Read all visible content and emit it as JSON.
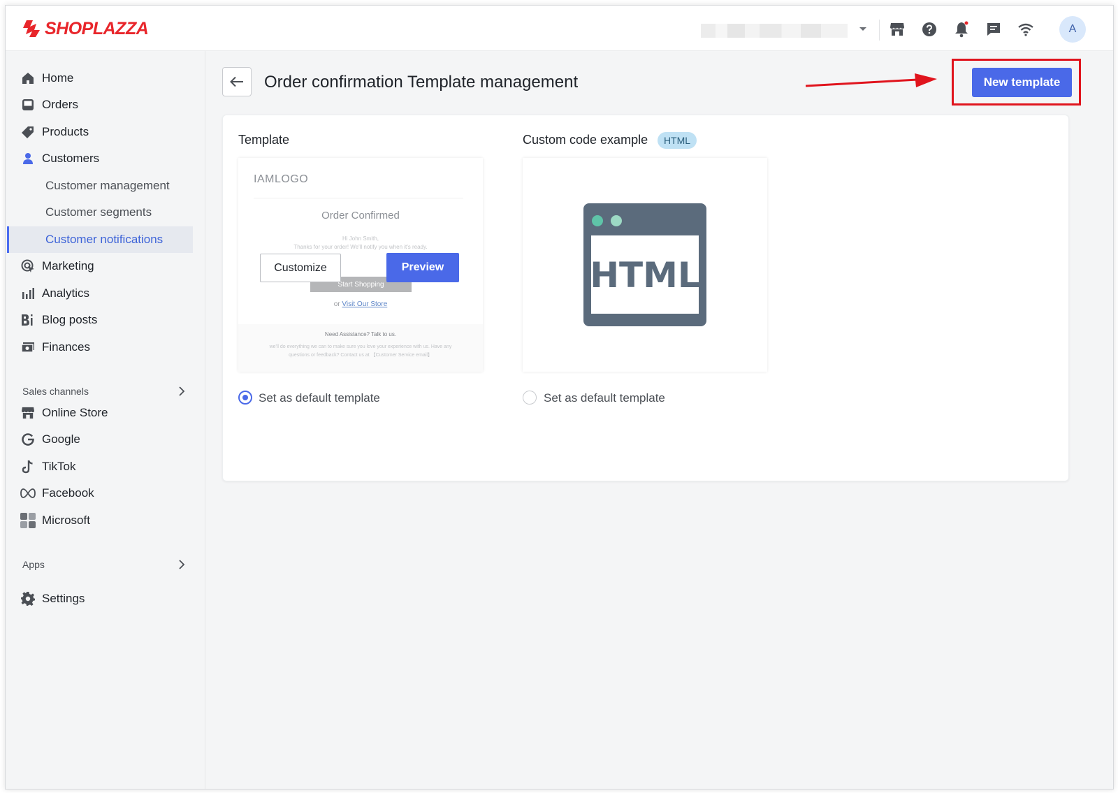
{
  "brand": {
    "name": "SHOPLAZZA",
    "color": "#e8262b"
  },
  "topbar": {
    "icons": [
      "store-icon",
      "help-icon",
      "bell-icon",
      "chat-icon",
      "wifi-icon"
    ],
    "avatar_initial": "A"
  },
  "sidebar": {
    "items": [
      {
        "label": "Home",
        "icon": "home-icon"
      },
      {
        "label": "Orders",
        "icon": "inbox-icon"
      },
      {
        "label": "Products",
        "icon": "tag-icon"
      },
      {
        "label": "Customers",
        "icon": "person-icon"
      },
      {
        "label": "Marketing",
        "icon": "target-icon"
      },
      {
        "label": "Analytics",
        "icon": "bar-chart-icon"
      },
      {
        "label": "Blog posts",
        "icon": "blog-icon"
      },
      {
        "label": "Finances",
        "icon": "finance-icon"
      }
    ],
    "sub_items": [
      {
        "label": "Customer management"
      },
      {
        "label": "Customer segments"
      },
      {
        "label": "Customer notifications",
        "active": true
      }
    ],
    "sales_channels_label": "Sales channels",
    "channels": [
      {
        "label": "Online Store",
        "icon": "store-icon"
      },
      {
        "label": "Google",
        "icon": "google-icon"
      },
      {
        "label": "TikTok",
        "icon": "tiktok-icon"
      },
      {
        "label": "Facebook",
        "icon": "meta-icon"
      },
      {
        "label": "Microsoft",
        "icon": "microsoft-icon"
      }
    ],
    "apps_label": "Apps",
    "settings_label": "Settings"
  },
  "page": {
    "title": "Order confirmation Template management",
    "new_template_label": "New template"
  },
  "templates": {
    "col1_title": "Template",
    "col2_title": "Custom code example",
    "html_badge": "HTML",
    "preview": {
      "logo": "IAMLOGO",
      "title": "Order Confirmed",
      "greeting": "Hi John Smith,",
      "message": "Thanks for your order! We'll notify you when it's ready.",
      "shop_button": "Start Shopping",
      "or_text": "or",
      "visit_link": "Visit Our Store",
      "help_title": "Need Assistance? Talk to us.",
      "help_line1": "we'll do everything we can to make sure you love your experience with us. Have any",
      "help_line2": "questions or feedback? Contact us at  【Customer Service email】"
    },
    "customize_label": "Customize",
    "preview_label": "Preview",
    "html_illustration_text": "HTML",
    "default_label_1": "Set as default template",
    "default_label_2": "Set as default template",
    "default_selected": 1
  },
  "colors": {
    "primary": "#4a69e8",
    "highlight": "#e0141d"
  }
}
